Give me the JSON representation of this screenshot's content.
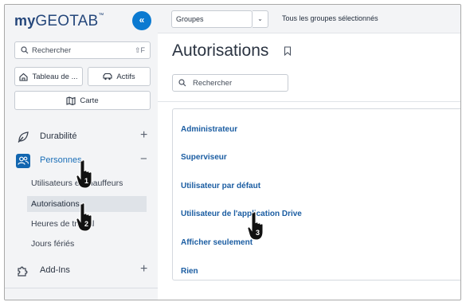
{
  "sidebar": {
    "logo": {
      "my": "my",
      "geotab": "GEOTAB",
      "tm": "™"
    },
    "collapse_label": "«",
    "search": {
      "placeholder": "Rechercher",
      "shortcut": "⇧F"
    },
    "buttons": {
      "tableau": "Tableau de ...",
      "actifs": "Actifs",
      "carte": "Carte"
    },
    "nav": {
      "durabilite": "Durabilité",
      "personnes": "Personnes",
      "addins": "Add-Ins",
      "plus": "+",
      "minus": "−"
    },
    "sub_items": [
      "Utilisateurs et chauffeurs",
      "Autorisations",
      "Heures de travail",
      "Jours fériés"
    ]
  },
  "topbar": {
    "groups_label": "Groupes",
    "groups_dropdown": "⌄",
    "groups_all": "Tous les groupes sélectionnés"
  },
  "main": {
    "title": "Autorisations",
    "search_placeholder": "Rechercher",
    "list": [
      "Administrateur",
      "Superviseur",
      "Utilisateur par défaut",
      "Utilisateur de l'application Drive",
      "Afficher seulement",
      "Rien"
    ]
  },
  "cursors": [
    "1",
    "2",
    "3"
  ],
  "colors": {
    "accent": "#0b7ad1",
    "link": "#1b5da2",
    "brand": "#25477b"
  }
}
